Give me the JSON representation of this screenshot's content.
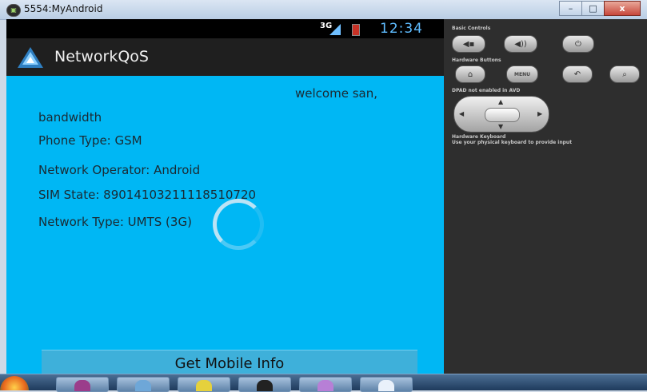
{
  "window": {
    "title": "5554:MyAndroid",
    "controls": [
      "–",
      "□",
      "x"
    ]
  },
  "status_bar": {
    "network": "3G",
    "time": "12:34"
  },
  "app_bar": {
    "title": "NetworkQoS"
  },
  "content": {
    "welcome": "welcome san,",
    "bandwidth": "bandwidth",
    "phone_type": "Phone Type: GSM",
    "network_operator": "Network Operator: Android",
    "sim_state": "SIM State: 89014103211118510720",
    "network_type": "Network Type: UMTS (3G)"
  },
  "button": {
    "label": "Get Mobile Info"
  },
  "controls_panel": {
    "basic_controls": "Basic Controls",
    "hardware_buttons": "Hardware Buttons",
    "menu_label": "MENU",
    "dpad_note": "DPAD not enabled in AVD",
    "keyboard_title": "Hardware Keyboard",
    "keyboard_note": "Use your physical keyboard to provide input"
  },
  "colors": {
    "screen_bg": "#00b7f4",
    "action_bar": "#1f1f1f",
    "panel_bg": "#2e2e2e",
    "button_bg": "#3eb0da"
  },
  "icons": [
    "app-icon",
    "signal-icon",
    "battery-icon",
    "volume-down-icon",
    "volume-up-icon",
    "power-icon",
    "home-icon",
    "back-icon",
    "search-icon",
    "dpad-icon",
    "spinner-icon"
  ]
}
